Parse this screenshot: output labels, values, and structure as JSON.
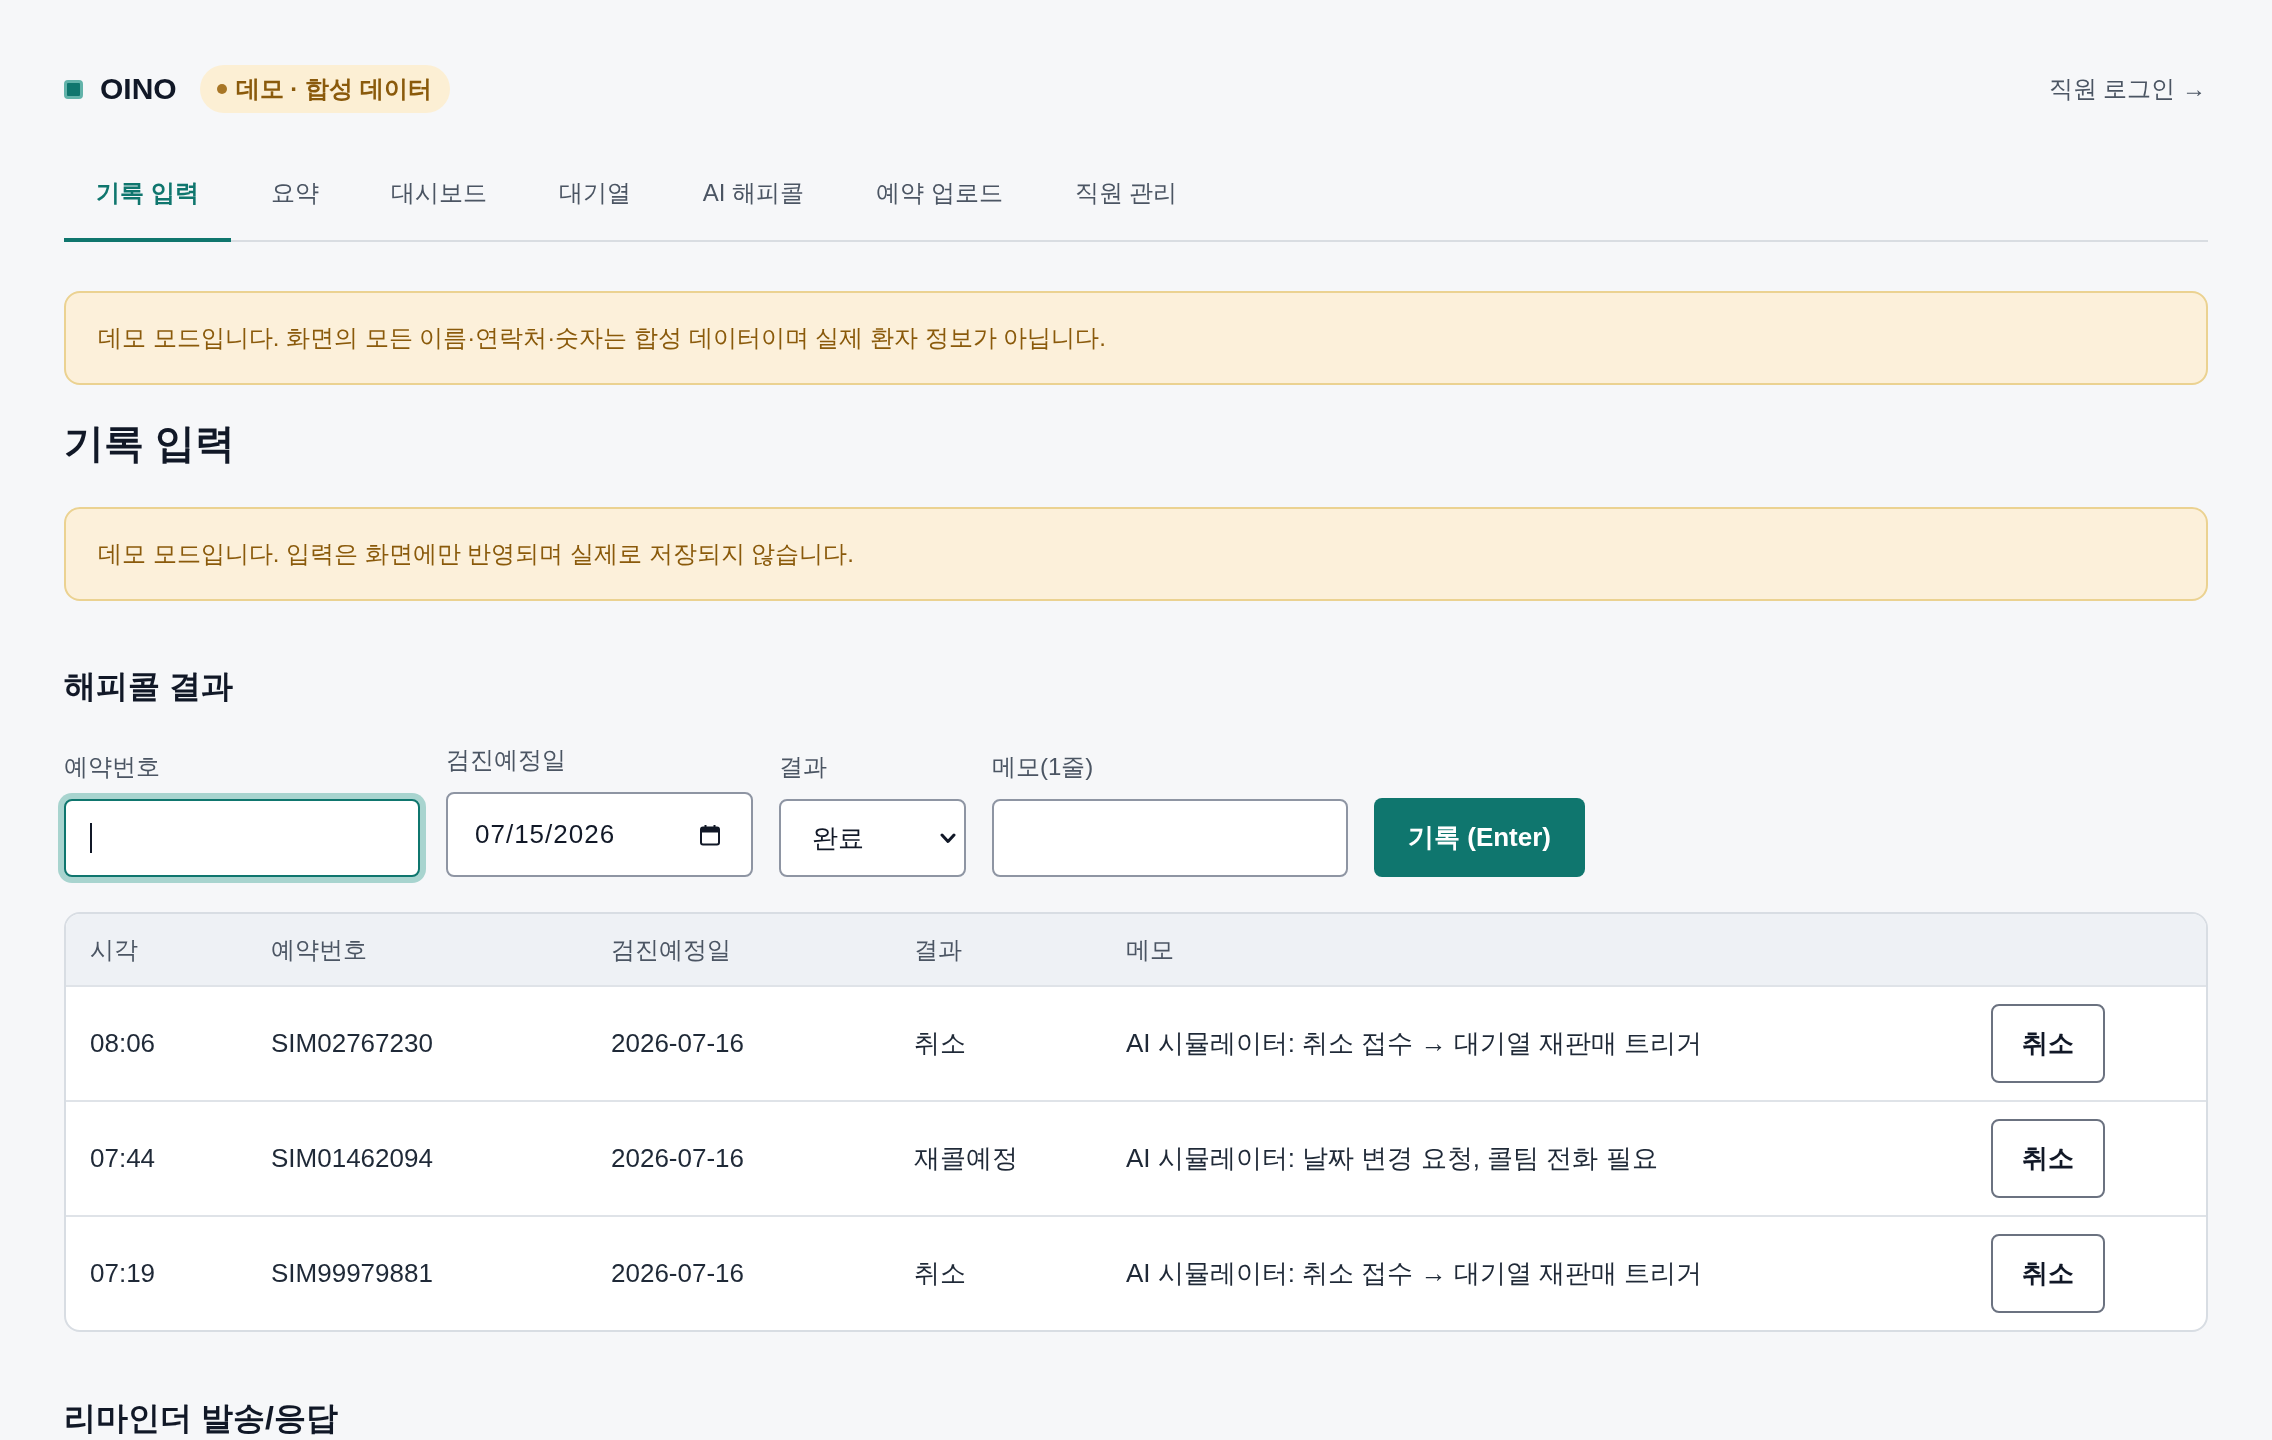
{
  "header": {
    "brand": "OINO",
    "badge": "데모 · 합성 데이터",
    "login_link": "직원 로그인 →"
  },
  "tabs": [
    {
      "label": "기록 입력",
      "selected": true
    },
    {
      "label": "요약",
      "selected": false
    },
    {
      "label": "대시보드",
      "selected": false
    },
    {
      "label": "대기열",
      "selected": false
    },
    {
      "label": "AI 해피콜",
      "selected": false
    },
    {
      "label": "예약 업로드",
      "selected": false
    },
    {
      "label": "직원 관리",
      "selected": false
    }
  ],
  "demo_notice": "데모 모드입니다. 화면의 모든 이름·연락처·숫자는 합성 데이터이며 실제 환자 정보가 아닙니다.",
  "page_title": "기록 입력",
  "input_notice": "데모 모드입니다. 입력은 화면에만 반영되며 실제로 저장되지 않습니다.",
  "happy_call": {
    "title": "해피콜 결과",
    "fields": [
      {
        "kind": "text",
        "label": "예약번호",
        "focused": true
      },
      {
        "kind": "date",
        "label": "검진예정일",
        "value": "07/15/2026",
        "focused": false
      },
      {
        "kind": "select",
        "label": "결과",
        "value": "완료",
        "focused": false
      },
      {
        "kind": "text",
        "label": "메모(1줄)",
        "focused": false
      }
    ],
    "submit_button": "기록 (Enter)",
    "table": {
      "columns": [
        "시각",
        "예약번호",
        "검진예정일",
        "결과",
        "메모"
      ],
      "rows": [
        {
          "cells": [
            "08:06",
            "SIM02767230",
            "2026-07-16",
            "취소",
            "AI 시뮬레이터: 취소 접수 → 대기열 재판매 트리거"
          ],
          "action": "취소"
        },
        {
          "cells": [
            "07:44",
            "SIM01462094",
            "2026-07-16",
            "재콜예정",
            "AI 시뮬레이터: 날짜 변경 요청, 콜팀 전화 필요"
          ],
          "action": "취소"
        },
        {
          "cells": [
            "07:19",
            "SIM99979881",
            "2026-07-16",
            "취소",
            "AI 시뮬레이터: 취소 접수 → 대기열 재판매 트리거"
          ],
          "action": "취소"
        }
      ]
    }
  },
  "reminder": {
    "title": "리마인더 발송/응답"
  }
}
